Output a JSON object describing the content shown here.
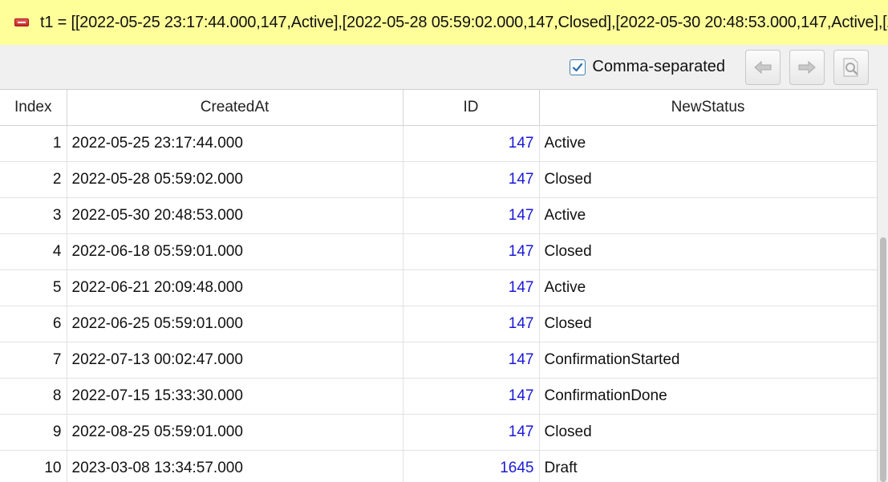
{
  "expression": {
    "text": "t1 = [[2022-05-25 23:17:44.000,147,Active],[2022-05-28 05:59:02.000,147,Closed],[2022-05-30 20:48:53.000,147,Active],[2022-06-18 05:59:01.000,147,Closed],[2022-06-21 20:09:48.000,147,Active]"
  },
  "toolbar": {
    "comma_separated_label": "Comma-separated",
    "comma_separated_checked": true,
    "icons": [
      "arrow-left-icon",
      "arrow-right-icon",
      "document-search-icon"
    ]
  },
  "table": {
    "columns": [
      "Index",
      "CreatedAt",
      "ID",
      "NewStatus"
    ],
    "rows": [
      {
        "index": "1",
        "created_at": "2022-05-25 23:17:44.000",
        "id": "147",
        "status": "Active"
      },
      {
        "index": "2",
        "created_at": "2022-05-28 05:59:02.000",
        "id": "147",
        "status": "Closed"
      },
      {
        "index": "3",
        "created_at": "2022-05-30 20:48:53.000",
        "id": "147",
        "status": "Active"
      },
      {
        "index": "4",
        "created_at": "2022-06-18 05:59:01.000",
        "id": "147",
        "status": "Closed"
      },
      {
        "index": "5",
        "created_at": "2022-06-21 20:09:48.000",
        "id": "147",
        "status": "Active"
      },
      {
        "index": "6",
        "created_at": "2022-06-25 05:59:01.000",
        "id": "147",
        "status": "Closed"
      },
      {
        "index": "7",
        "created_at": "2022-07-13 00:02:47.000",
        "id": "147",
        "status": "ConfirmationStarted"
      },
      {
        "index": "8",
        "created_at": "2022-07-15 15:33:30.000",
        "id": "147",
        "status": "ConfirmationDone"
      },
      {
        "index": "9",
        "created_at": "2022-08-25 05:59:01.000",
        "id": "147",
        "status": "Closed"
      },
      {
        "index": "10",
        "created_at": "2023-03-08 13:34:57.000",
        "id": "1645",
        "status": "Draft"
      }
    ]
  },
  "colors": {
    "expression_bg": "#ffff99",
    "id_text": "#1a1ad6",
    "checkbox_accent": "#3c7fb1"
  }
}
